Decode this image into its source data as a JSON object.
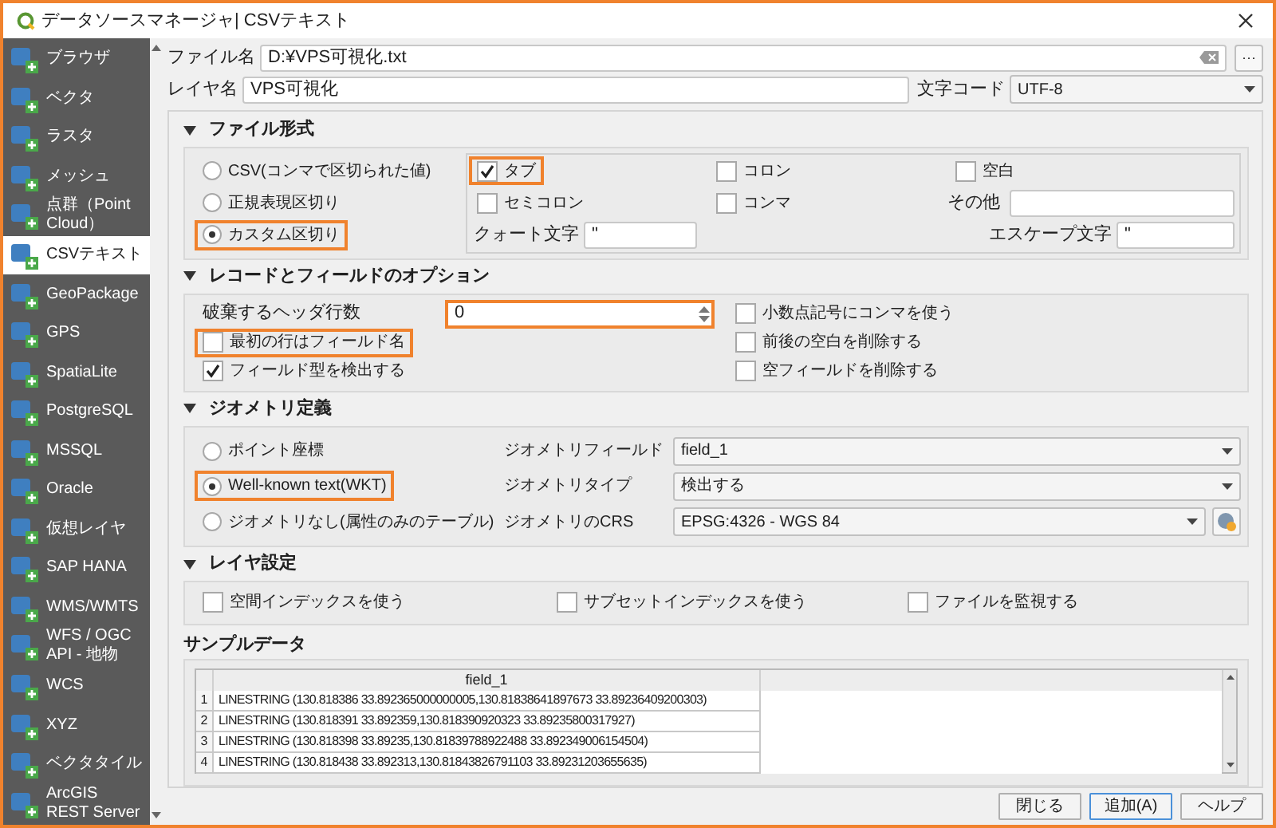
{
  "window": {
    "title": "データソースマネージャ| CSVテキスト"
  },
  "sidebar": {
    "items": [
      {
        "label": "ブラウザ",
        "selected": false
      },
      {
        "label": "ベクタ",
        "selected": false
      },
      {
        "label": "ラスタ",
        "selected": false
      },
      {
        "label": "メッシュ",
        "selected": false
      },
      {
        "label": "点群（Point Cloud）",
        "selected": false
      },
      {
        "label": "CSVテキスト",
        "selected": true
      },
      {
        "label": "GeoPackage",
        "selected": false
      },
      {
        "label": "GPS",
        "selected": false
      },
      {
        "label": "SpatiaLite",
        "selected": false
      },
      {
        "label": "PostgreSQL",
        "selected": false
      },
      {
        "label": "MSSQL",
        "selected": false
      },
      {
        "label": "Oracle",
        "selected": false
      },
      {
        "label": "仮想レイヤ",
        "selected": false
      },
      {
        "label": "SAP HANA",
        "selected": false
      },
      {
        "label": "WMS/WMTS",
        "selected": false
      },
      {
        "label": "WFS / OGC API - 地物",
        "selected": false
      },
      {
        "label": "WCS",
        "selected": false
      },
      {
        "label": "XYZ",
        "selected": false
      },
      {
        "label": "ベクタタイル",
        "selected": false
      },
      {
        "label": "ArcGIS REST Server",
        "selected": false
      }
    ]
  },
  "file": {
    "label": "ファイル名",
    "value": "D:¥VPS可視化.txt",
    "browse": "···"
  },
  "layer": {
    "label": "レイヤ名",
    "value": "VPS可視化",
    "encoding_label": "文字コード",
    "encoding": "UTF-8"
  },
  "file_format": {
    "title": "ファイル形式",
    "expanded": true,
    "formats": [
      {
        "label": "CSV(コンマで区切られた値)",
        "selected": false,
        "highlighted": false
      },
      {
        "label": "正規表現区切り",
        "selected": false,
        "highlighted": false
      },
      {
        "label": "カスタム区切り",
        "selected": true,
        "highlighted": true
      }
    ],
    "delimiters": [
      {
        "label": "タブ",
        "checked": true,
        "highlighted": true
      },
      {
        "label": "コロン",
        "checked": false,
        "highlighted": false
      },
      {
        "label": "空白",
        "checked": false,
        "highlighted": false
      },
      {
        "label": "セミコロン",
        "checked": false,
        "highlighted": false
      },
      {
        "label": "コンマ",
        "checked": false,
        "highlighted": false
      }
    ],
    "other_label": "その他",
    "quote_label": "クォート文字",
    "quote": "\"",
    "escape_label": "エスケープ文字",
    "escape": "\""
  },
  "records": {
    "title": "レコードとフィールドのオプション",
    "expanded": true,
    "skip_label": "破棄するヘッダ行数",
    "skip_value": "0",
    "skip_highlighted": true,
    "left_options": [
      {
        "label": "最初の行はフィールド名",
        "checked": false,
        "highlighted": true
      },
      {
        "label": "フィールド型を検出する",
        "checked": true,
        "highlighted": false
      }
    ],
    "right_options": [
      {
        "label": "小数点記号にコンマを使う",
        "checked": false,
        "highlighted": false
      },
      {
        "label": "前後の空白を削除する",
        "checked": false,
        "highlighted": false
      },
      {
        "label": "空フィールドを削除する",
        "checked": false,
        "highlighted": false
      }
    ]
  },
  "geometry": {
    "title": "ジオメトリ定義",
    "expanded": true,
    "modes": [
      {
        "label": "ポイント座標",
        "selected": false,
        "highlighted": false
      },
      {
        "label": "Well-known text(WKT)",
        "selected": true,
        "highlighted": true
      },
      {
        "label": "ジオメトリなし(属性のみのテーブル)",
        "selected": false,
        "highlighted": false
      }
    ],
    "fields": [
      {
        "label": "ジオメトリフィールド",
        "value": "field_1",
        "kind": "select"
      },
      {
        "label": "ジオメトリタイプ",
        "value": "検出する",
        "kind": "select"
      },
      {
        "label": "ジオメトリのCRS",
        "value": "EPSG:4326 - WGS 84",
        "kind": "crs"
      }
    ]
  },
  "layer_settings": {
    "title": "レイヤ設定",
    "expanded": true,
    "options": [
      {
        "label": "空間インデックスを使う",
        "checked": false,
        "highlighted": false
      },
      {
        "label": "サブセットインデックスを使う",
        "checked": false,
        "highlighted": false
      },
      {
        "label": "ファイルを監視する",
        "checked": false,
        "highlighted": false
      }
    ]
  },
  "sample": {
    "title": "サンプルデータ",
    "columns": [
      "field_1"
    ],
    "rows": [
      {
        "number": "1",
        "cells": [
          "LINESTRING (130.818386 33.892365000000005,130.81838641897673 33.89236409200303)"
        ]
      },
      {
        "number": "2",
        "cells": [
          "LINESTRING (130.818391 33.892359,130.818390920323 33.89235800317927)"
        ]
      },
      {
        "number": "3",
        "cells": [
          "LINESTRING (130.818398 33.89235,130.81839788922488 33.892349006154504)"
        ]
      },
      {
        "number": "4",
        "cells": [
          "LINESTRING (130.818438 33.892313,130.81843826791103 33.89231203655635)"
        ]
      }
    ]
  },
  "buttons": [
    {
      "label": "閉じる",
      "default": false
    },
    {
      "label": "追加(A)",
      "default": true
    },
    {
      "label": "ヘルプ",
      "default": false
    }
  ]
}
